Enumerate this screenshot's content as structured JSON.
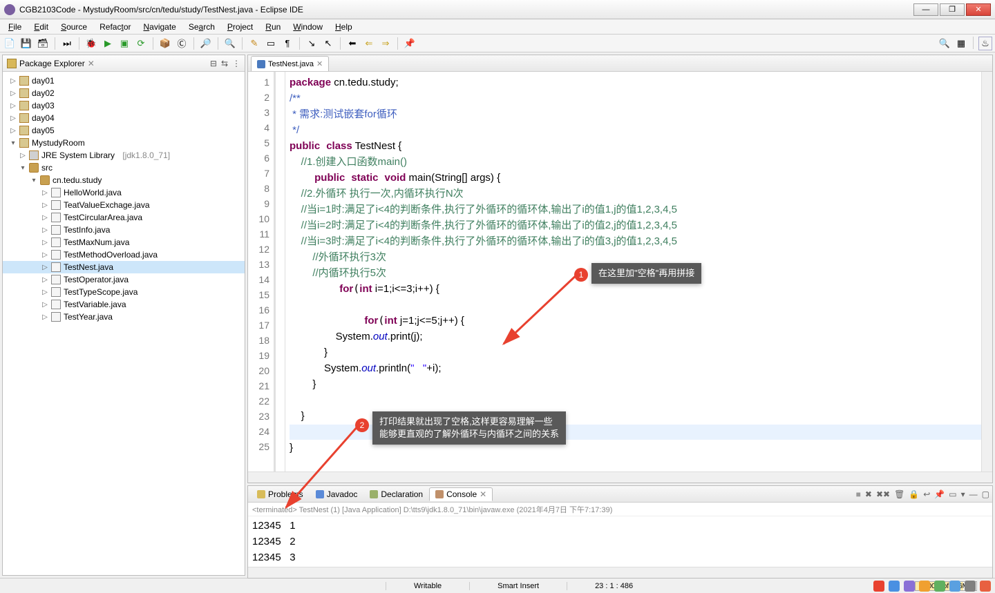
{
  "window": {
    "title": "CGB2103Code - MystudyRoom/src/cn/tedu/study/TestNest.java - Eclipse IDE"
  },
  "menu": {
    "file": "File",
    "edit": "Edit",
    "source": "Source",
    "refactor": "Refactor",
    "navigate": "Navigate",
    "search": "Search",
    "project": "Project",
    "run": "Run",
    "window": "Window",
    "help": "Help"
  },
  "explorer": {
    "title": "Package Explorer",
    "folders": [
      "day01",
      "day02",
      "day03",
      "day04",
      "day05"
    ],
    "project": "MystudyRoom",
    "jre": "JRE System Library",
    "jre_ver": "[jdk1.8.0_71]",
    "src": "src",
    "pkg": "cn.tedu.study",
    "files": [
      "HelloWorld.java",
      "TeatValueExchage.java",
      "TestCircularArea.java",
      "TestInfo.java",
      "TestMaxNum.java",
      "TestMethodOverload.java",
      "TestNest.java",
      "TestOperator.java",
      "TestTypeScope.java",
      "TestVariable.java",
      "TestYear.java"
    ],
    "selected": "TestNest.java"
  },
  "editor": {
    "tab": "TestNest.java",
    "lines": [
      "1",
      "2",
      "3",
      "4",
      "5",
      "6",
      "7",
      "8",
      "9",
      "10",
      "11",
      "12",
      "13",
      "14",
      "15",
      "16",
      "17",
      "18",
      "19",
      "20",
      "21",
      "22",
      "23",
      "24",
      "25"
    ],
    "l1_pkg": "package",
    "l1_name": " cn.tedu.study;",
    "l2": "/**",
    "l3": " * 需求:测试嵌套for循环",
    "l4": " */",
    "l5_pub": "public",
    "l5_cls": "class",
    "l5_name": " TestNest {",
    "l6": "    //1.创建入口函数main()",
    "l7_pub": "public",
    "l7_stat": "static",
    "l7_void": "void",
    "l7_rest": " main(String[] args) {",
    "l8": "    //2.外循环 执行一次,内循环执行N次",
    "l9": "    //当i=1时:满足了i<4的判断条件,执行了外循环的循环体,输出了i的值1,j的值1,2,3,4,5",
    "l10": "    //当i=2时:满足了i<4的判断条件,执行了外循环的循环体,输出了i的值2,j的值1,2,3,4,5",
    "l11": "    //当i=3时:满足了i<4的判断条件,执行了外循环的循环体,输出了i的值3,j的值1,2,3,4,5",
    "l12": "        //外循环执行3次",
    "l13": "        //内循环执行5次",
    "l14_for": "for",
    "l14_int": "int",
    "l14_rest": " i=1;i<=3;i++) {",
    "l16_for": "for",
    "l16_int": "int",
    "l16_rest": " j=1;j<=5;j++) {",
    "l17a": "                System.",
    "l17b": "out",
    "l17c": ".print(j);",
    "l18": "            }",
    "l19a": "            System.",
    "l19b": "out",
    "l19c": ".println(",
    "l19d": "\"   \"",
    "l19e": "+i);",
    "l20": "        }",
    "l22": "    }",
    "l24": "}"
  },
  "bottom": {
    "tabs": {
      "problems": "Problems",
      "javadoc": "Javadoc",
      "declaration": "Declaration",
      "console": "Console"
    },
    "terminated": "<terminated> TestNest (1) [Java Application] D:\\tts9\\jdk1.8.0_71\\bin\\javaw.exe (2021年4月7日 下午7:17:39)",
    "out1": "12345   1",
    "out2": "12345   2",
    "out3": "12345   3"
  },
  "status": {
    "writable": "Writable",
    "insert": "Smart Insert",
    "pos": "23 : 1 : 486",
    "mem": "200M of 256M"
  },
  "annotations": {
    "a1_num": "1",
    "a1_text": "在这里加\"空格\"再用拼接",
    "a2_num": "2",
    "a2_text1": "打印结果就出现了空格,这样更容易理解一些",
    "a2_text2": "能够更直观的了解外循环与内循环之间的关系"
  }
}
